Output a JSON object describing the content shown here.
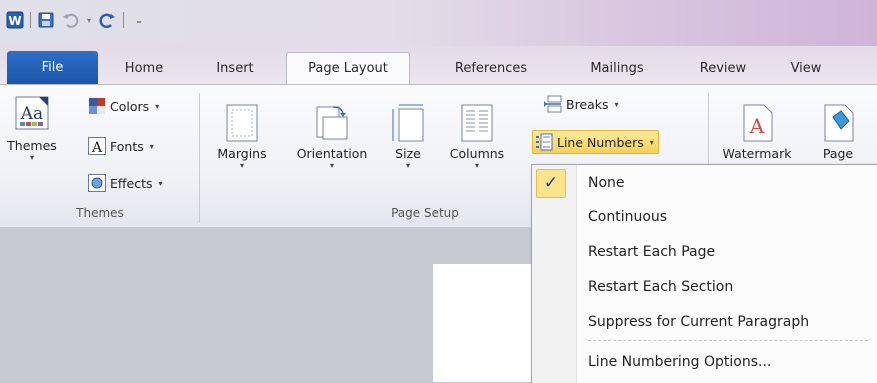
{
  "qat": {
    "icons": [
      "word-logo-icon",
      "save-icon",
      "undo-icon",
      "redo-icon",
      "customize-qat-icon"
    ]
  },
  "tabs": [
    {
      "label": "File"
    },
    {
      "label": "Home"
    },
    {
      "label": "Insert"
    },
    {
      "label": "Page Layout"
    },
    {
      "label": "References"
    },
    {
      "label": "Mailings"
    },
    {
      "label": "Review"
    },
    {
      "label": "View"
    }
  ],
  "ribbon": {
    "themes_group": {
      "label": "Themes",
      "themes_button": "Themes",
      "colors": "Colors",
      "fonts": "Fonts",
      "effects": "Effects"
    },
    "page_setup_group": {
      "label": "Page Setup",
      "margins": "Margins",
      "orientation": "Orientation",
      "size": "Size",
      "columns": "Columns",
      "breaks": "Breaks",
      "line_numbers": "Line Numbers"
    },
    "background_group": {
      "watermark": "Watermark",
      "page_color": "Page"
    }
  },
  "menu": {
    "items": [
      {
        "label": "None",
        "checked": true
      },
      {
        "label": "Continuous"
      },
      {
        "label": "Restart Each Page"
      },
      {
        "label": "Restart Each Section"
      },
      {
        "label": "Suppress for Current Paragraph"
      },
      {
        "label": "Line Numbering Options..."
      }
    ]
  },
  "colors": {
    "file_tab": "#1b56a8",
    "highlight": "#f8cf57"
  }
}
